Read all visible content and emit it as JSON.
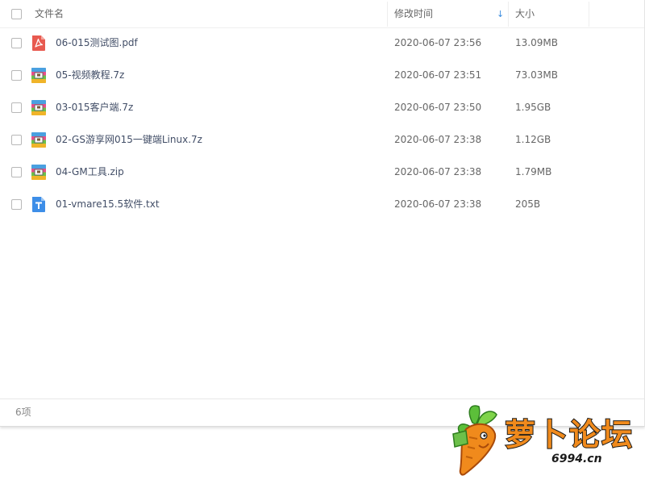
{
  "header": {
    "col_name": "文件名",
    "col_time": "修改时间",
    "col_size": "大小",
    "sort_indicator": "↓",
    "sort_icon": "sort-descending-arrow-icon"
  },
  "files": [
    {
      "name": "06-015测试图.pdf",
      "modified": "2020-06-07 23:56",
      "size": "13.09MB",
      "icon": "pdf-file-icon"
    },
    {
      "name": "05-视频教程.7z",
      "modified": "2020-06-07 23:51",
      "size": "73.03MB",
      "icon": "archive-file-icon"
    },
    {
      "name": "03-015客户端.7z",
      "modified": "2020-06-07 23:50",
      "size": "1.95GB",
      "icon": "archive-file-icon"
    },
    {
      "name": "02-GS游享网015一键端Linux.7z",
      "modified": "2020-06-07 23:38",
      "size": "1.12GB",
      "icon": "archive-file-icon"
    },
    {
      "name": "04-GM工具.zip",
      "modified": "2020-06-07 23:38",
      "size": "1.79MB",
      "icon": "archive-file-icon"
    },
    {
      "name": "01-vmare15.5软件.txt",
      "modified": "2020-06-07 23:38",
      "size": "205B",
      "icon": "text-file-icon"
    }
  ],
  "footer": {
    "item_count": "6项"
  },
  "watermark": {
    "brand_text": "萝卜论坛",
    "url": "6994.cn",
    "icon": "carrot-logo-icon"
  },
  "colors": {
    "accent": "#3b8cde",
    "pdf_red": "#e85a50",
    "txt_blue": "#3d8ee8",
    "logo_orange": "#f08a1c",
    "logo_green": "#5cbf3a"
  }
}
